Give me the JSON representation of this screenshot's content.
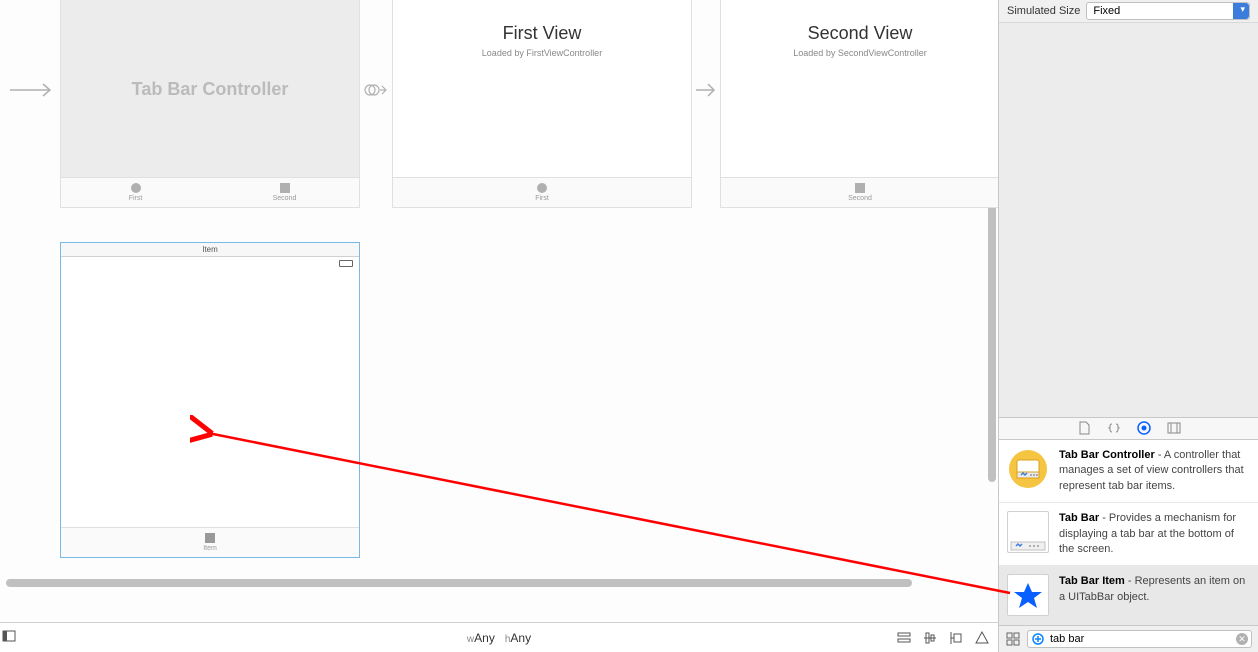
{
  "canvas": {
    "scenes": {
      "tabBarController": {
        "title": "Tab Bar Controller",
        "tabs": [
          {
            "label": "First"
          },
          {
            "label": "Second"
          }
        ]
      },
      "firstView": {
        "title": "First View",
        "subtitle": "Loaded by FirstViewController",
        "tab": {
          "label": "First"
        }
      },
      "secondView": {
        "title": "Second View",
        "subtitle": "Loaded by SecondViewController",
        "tab": {
          "label": "Second"
        }
      },
      "item": {
        "headerLabel": "Item",
        "tab": {
          "label": "Item"
        }
      }
    },
    "sizeClass": {
      "wLabel": "w",
      "wValue": "Any",
      "hLabel": "h",
      "hValue": "Any"
    }
  },
  "inspector": {
    "simulatedSize": {
      "label": "Simulated Size",
      "value": "Fixed"
    }
  },
  "library": {
    "items": [
      {
        "title": "Tab Bar Controller",
        "desc": " - A controller that manages a set of view controllers that represent tab bar items."
      },
      {
        "title": "Tab Bar",
        "desc": " - Provides a mechanism for displaying a tab bar at the bottom of the screen."
      },
      {
        "title": "Tab Bar Item",
        "desc": " - Represents an item on a UITabBar object."
      }
    ],
    "searchValue": "tab bar"
  }
}
